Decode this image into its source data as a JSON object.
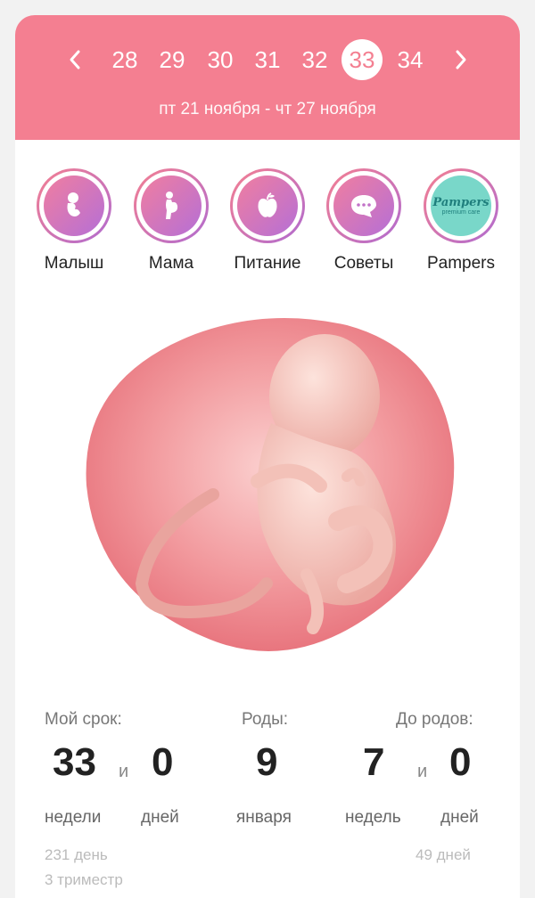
{
  "header": {
    "weeks": [
      "28",
      "29",
      "30",
      "31",
      "32",
      "33",
      "34"
    ],
    "active_week": "33",
    "date_range": "пт 21 ноября - чт 27 ноября",
    "prev_icon": "chevron-left-icon",
    "next_icon": "chevron-right-icon"
  },
  "categories": [
    {
      "label": "Малыш",
      "icon": "baby-icon"
    },
    {
      "label": "Мама",
      "icon": "pregnant-woman-icon"
    },
    {
      "label": "Питание",
      "icon": "apple-icon"
    },
    {
      "label": "Советы",
      "icon": "chat-bubble-icon"
    },
    {
      "label": "Pampers",
      "icon": "pampers-logo"
    }
  ],
  "pampers_logo": {
    "brand": "Pampers",
    "sub": "premium care"
  },
  "stats": {
    "term": {
      "label": "Мой срок:",
      "weeks": "33",
      "and": "и",
      "days": "0",
      "weeks_unit": "недели",
      "days_unit": "дней",
      "total_days": "231 день",
      "trimester": "3 триместр"
    },
    "birth": {
      "label": "Роды:",
      "day": "9",
      "month": "января"
    },
    "left": {
      "label": "До родов:",
      "weeks": "7",
      "and": "и",
      "days": "0",
      "weeks_unit": "недель",
      "days_unit": "дней",
      "total_days": "49 дней"
    }
  },
  "colors": {
    "accent": "#f47f91",
    "gradient_end": "#b06bd0",
    "pampers_bg": "#79d7c9"
  }
}
